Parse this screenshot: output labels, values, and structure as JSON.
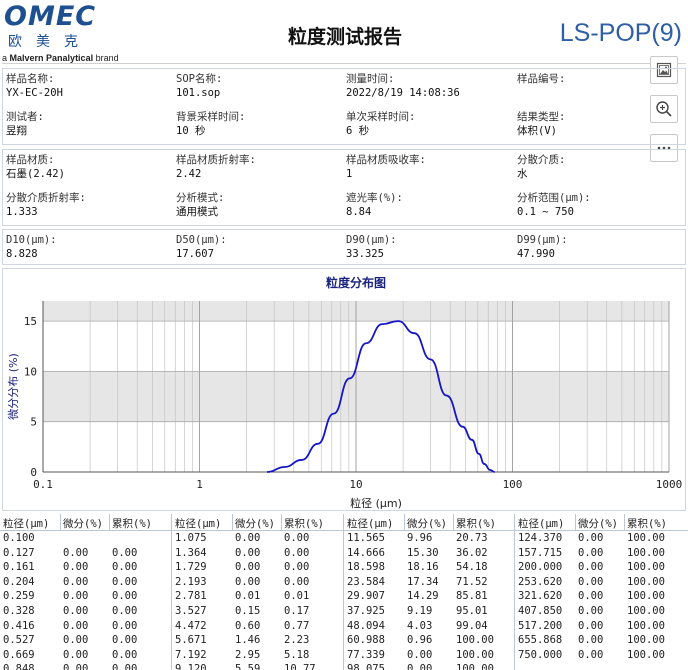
{
  "header": {
    "logo_text": "OMEC",
    "logo_cn": "欧美克",
    "logo_sub_a": "a",
    "logo_sub_b": "Malvern Panalytical",
    "logo_sub_c": "brand",
    "title": "粒度测试报告",
    "code": "LS-POP(9)"
  },
  "tools": {
    "image_icon": "image-icon",
    "zoom_icon": "zoom-in-icon",
    "more_icon": "more-icon"
  },
  "info1": [
    {
      "label": "样品名称:",
      "value": "YX-EC-20H"
    },
    {
      "label": "SOP名称:",
      "value": "101.sop"
    },
    {
      "label": "测量时间:",
      "value": "2022/8/19 14:08:36"
    },
    {
      "label": "样品编号:",
      "value": ""
    },
    {
      "label": "测试者:",
      "value": "昱翔"
    },
    {
      "label": "背景采样时间:",
      "value": "10 秒"
    },
    {
      "label": "单次采样时间:",
      "value": "6 秒"
    },
    {
      "label": "结果类型:",
      "value": "体积(V)"
    }
  ],
  "info2": [
    {
      "label": "样品材质:",
      "value": "石墨(2.42)"
    },
    {
      "label": "样品材质折射率:",
      "value": "2.42"
    },
    {
      "label": "样品材质吸收率:",
      "value": "1"
    },
    {
      "label": "分散介质:",
      "value": "水"
    },
    {
      "label": "分散介质折射率:",
      "value": "1.333"
    },
    {
      "label": "分析模式:",
      "value": "通用模式"
    },
    {
      "label": "遮光率(%):",
      "value": "8.84"
    },
    {
      "label": "分析范围(μm):",
      "value": "0.1 ~ 750"
    }
  ],
  "info3": [
    {
      "label": "D10(μm):",
      "value": "8.828"
    },
    {
      "label": "D50(μm):",
      "value": "17.607"
    },
    {
      "label": "D90(μm):",
      "value": "33.325"
    },
    {
      "label": "D99(μm):",
      "value": "47.990"
    }
  ],
  "chart_data": {
    "type": "line",
    "title": "粒度分布图",
    "xlabel": "粒径 (μm)",
    "ylabel": "微分分布 (%)",
    "x_scale": "log",
    "xlim": [
      0.1,
      1000
    ],
    "ylim": [
      0,
      17
    ],
    "x_ticks": [
      "0.1",
      "1",
      "10",
      "100",
      "1000"
    ],
    "y_ticks": [
      "0",
      "5",
      "10",
      "15"
    ],
    "grid": true,
    "series": [
      {
        "x": [
          2.7,
          3.5,
          4.5,
          5.7,
          7.2,
          9.1,
          11.6,
          14.7,
          18.6,
          23.6,
          29.9,
          37.9,
          48.1,
          55,
          61,
          66,
          72,
          77
        ],
        "y": [
          0,
          0.5,
          1.2,
          2.8,
          5.8,
          9.3,
          12.8,
          14.7,
          15.0,
          13.8,
          11.2,
          7.6,
          4.5,
          3.2,
          1.8,
          0.8,
          0.2,
          0
        ],
        "color": "#1414c8"
      }
    ],
    "band_color": "#e6e6e6"
  },
  "table": {
    "headers": [
      "粒径(μm)",
      "微分(%)",
      "累积(%)"
    ],
    "columns": [
      [
        [
          "0.100",
          "",
          ""
        ],
        [
          "0.127",
          "0.00",
          "0.00"
        ],
        [
          "0.161",
          "0.00",
          "0.00"
        ],
        [
          "0.204",
          "0.00",
          "0.00"
        ],
        [
          "0.259",
          "0.00",
          "0.00"
        ],
        [
          "0.328",
          "0.00",
          "0.00"
        ],
        [
          "0.416",
          "0.00",
          "0.00"
        ],
        [
          "0.527",
          "0.00",
          "0.00"
        ],
        [
          "0.669",
          "0.00",
          "0.00"
        ],
        [
          "0.848",
          "0.00",
          "0.00"
        ]
      ],
      [
        [
          "1.075",
          "0.00",
          "0.00"
        ],
        [
          "1.364",
          "0.00",
          "0.00"
        ],
        [
          "1.729",
          "0.00",
          "0.00"
        ],
        [
          "2.193",
          "0.00",
          "0.00"
        ],
        [
          "2.781",
          "0.01",
          "0.01"
        ],
        [
          "3.527",
          "0.15",
          "0.17"
        ],
        [
          "4.472",
          "0.60",
          "0.77"
        ],
        [
          "5.671",
          "1.46",
          "2.23"
        ],
        [
          "7.192",
          "2.95",
          "5.18"
        ],
        [
          "9.120",
          "5.59",
          "10.77"
        ]
      ],
      [
        [
          "11.565",
          "9.96",
          "20.73"
        ],
        [
          "14.666",
          "15.30",
          "36.02"
        ],
        [
          "18.598",
          "18.16",
          "54.18"
        ],
        [
          "23.584",
          "17.34",
          "71.52"
        ],
        [
          "29.907",
          "14.29",
          "85.81"
        ],
        [
          "37.925",
          "9.19",
          "95.01"
        ],
        [
          "48.094",
          "4.03",
          "99.04"
        ],
        [
          "60.988",
          "0.96",
          "100.00"
        ],
        [
          "77.339",
          "0.00",
          "100.00"
        ],
        [
          "98.075",
          "0.00",
          "100.00"
        ]
      ],
      [
        [
          "124.370",
          "0.00",
          "100.00"
        ],
        [
          "157.715",
          "0.00",
          "100.00"
        ],
        [
          "200.000",
          "0.00",
          "100.00"
        ],
        [
          "253.620",
          "0.00",
          "100.00"
        ],
        [
          "321.620",
          "0.00",
          "100.00"
        ],
        [
          "407.850",
          "0.00",
          "100.00"
        ],
        [
          "517.200",
          "0.00",
          "100.00"
        ],
        [
          "655.868",
          "0.00",
          "100.00"
        ],
        [
          "750.000",
          "0.00",
          "100.00"
        ]
      ]
    ]
  }
}
